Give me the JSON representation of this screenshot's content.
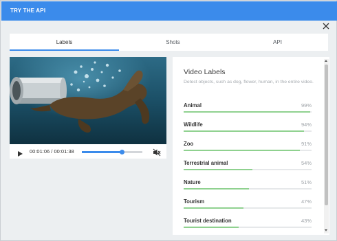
{
  "header": {
    "title": "TRY THE API"
  },
  "tabs": [
    {
      "label": "Labels",
      "active": true
    },
    {
      "label": "Shots",
      "active": false
    },
    {
      "label": "API",
      "active": false
    }
  ],
  "video": {
    "current_time": "00:01:06",
    "separator": " / ",
    "duration": "00:01:38",
    "progress_fraction": 0.67,
    "muted": true
  },
  "labels_panel": {
    "title": "Video Labels",
    "subtitle": "Detect objects, such as dog, flower, human, in the entire video.",
    "items": [
      {
        "name": "Animal",
        "percent": "99%",
        "value": 0.99
      },
      {
        "name": "Wildlife",
        "percent": "94%",
        "value": 0.94
      },
      {
        "name": "Zoo",
        "percent": "91%",
        "value": 0.91
      },
      {
        "name": "Terrestrial animal",
        "percent": "54%",
        "value": 0.54
      },
      {
        "name": "Nature",
        "percent": "51%",
        "value": 0.51
      },
      {
        "name": "Tourism",
        "percent": "47%",
        "value": 0.47
      },
      {
        "name": "Tourist destination",
        "percent": "43%",
        "value": 0.43
      }
    ]
  },
  "colors": {
    "accent": "#3b8beb",
    "label_bar": "#8fd18f",
    "background": "#eceff1"
  },
  "icons": {
    "close": "close-icon",
    "play": "play-icon",
    "mute": "volume-off-icon"
  }
}
